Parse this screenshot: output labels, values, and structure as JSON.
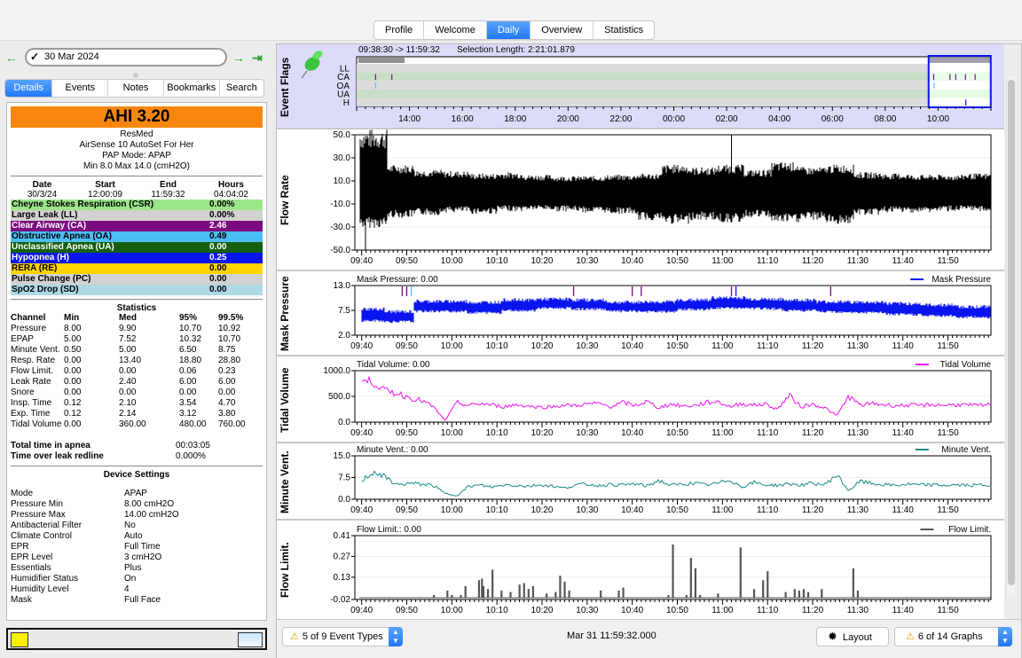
{
  "main_tabs": [
    {
      "label": "Profile",
      "active": false
    },
    {
      "label": "Welcome",
      "active": false
    },
    {
      "label": "Daily",
      "active": true
    },
    {
      "label": "Overview",
      "active": false
    },
    {
      "label": "Statistics",
      "active": false
    }
  ],
  "nav": {
    "date": "30 Mar 2024",
    "back_icon": "arrow-left-icon",
    "forward_icon": "arrow-right-icon",
    "last_icon": "arrow-to-end-icon"
  },
  "left_tabs": [
    {
      "label": "Details",
      "active": true
    },
    {
      "label": "Events",
      "active": false
    },
    {
      "label": "Notes",
      "active": false
    },
    {
      "label": "Bookmarks",
      "active": false
    },
    {
      "label": "Search",
      "active": false
    }
  ],
  "summary": {
    "ahi_label": "AHI  3.20",
    "ahi_color": "#f7860e",
    "device_lines": [
      "ResMed",
      "AirSense 10 AutoSet For Her",
      "PAP Mode: APAP",
      "Min 8.0 Max 14.0 (cmH2O)"
    ],
    "session_headers": [
      "Date",
      "Start",
      "End",
      "Hours"
    ],
    "session_values": [
      "30/3/24",
      "12:00:09",
      "11:59:32",
      "04:04:02"
    ]
  },
  "events": [
    {
      "label": "Cheyne Stokes Respiration (CSR)",
      "value": "0.00%",
      "bg": "#9be58a",
      "fg": "#000000"
    },
    {
      "label": "Large Leak (LL)",
      "value": "0.00%",
      "bg": "#d2d2d2",
      "fg": "#000000"
    },
    {
      "label": "Clear Airway (CA)",
      "value": "2.46",
      "bg": "#7a0b7e",
      "fg": "#ffffff"
    },
    {
      "label": "Obstructive Apnea (OA)",
      "value": "0.49",
      "bg": "#4dbdf5",
      "fg": "#000000"
    },
    {
      "label": "Unclassified Apnea (UA)",
      "value": "0.00",
      "bg": "#155f0e",
      "fg": "#ffffff"
    },
    {
      "label": "Hypopnea (H)",
      "value": "0.25",
      "bg": "#0a14ee",
      "fg": "#ffffff"
    },
    {
      "label": "RERA (RE)",
      "value": "0.00",
      "bg": "#ffd400",
      "fg": "#000000"
    },
    {
      "label": "Pulse Change (PC)",
      "value": "0.00",
      "bg": "#d2d2d2",
      "fg": "#000000"
    },
    {
      "label": "SpO2 Drop (SD)",
      "value": "0.00",
      "bg": "#add8e6",
      "fg": "#000000"
    }
  ],
  "statistics": {
    "title": "Statistics",
    "headers": [
      "Channel",
      "Min",
      "Med",
      "95%",
      "99.5%"
    ],
    "rows": [
      [
        "Pressure",
        "8.00",
        "9.90",
        "10.70",
        "10.92"
      ],
      [
        "EPAP",
        "5.00",
        "7.52",
        "10.32",
        "10.70"
      ],
      [
        "Minute Vent.",
        "0.50",
        "5.00",
        "6.50",
        "8.75"
      ],
      [
        "Resp. Rate",
        "0.00",
        "13.40",
        "18.80",
        "28.80"
      ],
      [
        "Flow Limit.",
        "0.00",
        "0.00",
        "0.06",
        "0.23"
      ],
      [
        "Leak Rate",
        "0.00",
        "2.40",
        "6.00",
        "6.00"
      ],
      [
        "Snore",
        "0.00",
        "0.00",
        "0.00",
        "0.00"
      ],
      [
        "Insp. Time",
        "0.12",
        "2.10",
        "3.54",
        "4.70"
      ],
      [
        "Exp. Time",
        "0.12",
        "2.14",
        "3.12",
        "3.80"
      ],
      [
        "Tidal Volume",
        "0.00",
        "360.00",
        "480.00",
        "760.00"
      ]
    ]
  },
  "totals": [
    {
      "label": "Total time in apnea",
      "value": "00:03:05"
    },
    {
      "label": "Time over leak redline",
      "value": "0.000%"
    }
  ],
  "device_settings": {
    "title": "Device Settings",
    "rows": [
      [
        "Mode",
        "APAP"
      ],
      [
        "Pressure Min",
        "8.00 cmH2O"
      ],
      [
        "Pressure Max",
        "14.00 cmH2O"
      ],
      [
        "Antibacterial Filter",
        "No"
      ],
      [
        "Climate Control",
        "Auto"
      ],
      [
        "EPR",
        "Full Time"
      ],
      [
        "EPR Level",
        "3 cmH2O"
      ],
      [
        "Essentials",
        "Plus"
      ],
      [
        "Humidifier Status",
        "On"
      ],
      [
        "Humidity Level",
        "4"
      ],
      [
        "Mask",
        "Full Face"
      ]
    ]
  },
  "event_flags": {
    "title": "Event Flags",
    "range_text": "09:38:30 -> 11:59:32",
    "selection_text": "Selection Length: 2:21:01.879",
    "rows": [
      "LL",
      "CA",
      "OA",
      "UA",
      "H"
    ],
    "x_ticks": [
      "14:00",
      "16:00",
      "18:00",
      "20:00",
      "22:00",
      "00:00",
      "02:00",
      "04:00",
      "06:00",
      "08:00",
      "10:00"
    ],
    "x_range": [
      "12:00",
      "12:00"
    ],
    "selection": [
      "09:38:30",
      "11:59:32"
    ],
    "markers": [
      {
        "row": "CA",
        "time": "12:43",
        "color": "#7a0b7e"
      },
      {
        "row": "CA",
        "time": "13:20",
        "color": "#7a0b7e"
      },
      {
        "row": "OA",
        "time": "12:43",
        "color": "#4dbdf5"
      },
      {
        "row": "CA",
        "time": "09:50",
        "color": "#7a0b7e"
      },
      {
        "row": "CA",
        "time": "10:27",
        "color": "#7a0b7e"
      },
      {
        "row": "CA",
        "time": "10:40",
        "color": "#7a0b7e"
      },
      {
        "row": "CA",
        "time": "11:02",
        "color": "#7a0b7e"
      },
      {
        "row": "CA",
        "time": "11:24",
        "color": "#7a0b7e"
      },
      {
        "row": "OA",
        "time": "09:51",
        "color": "#4dbdf5"
      },
      {
        "row": "H",
        "time": "11:03",
        "color": "#0a14ee"
      }
    ]
  },
  "chart_data": [
    {
      "type": "line",
      "title": "Flow Rate",
      "ylabel": "Flow Rate",
      "ylim": [
        -50,
        50
      ],
      "y_ticks": [
        "50.0",
        "30.0",
        "10.0",
        "-10.0",
        "-30.0",
        "-50.0"
      ],
      "x_ticks": [
        "09:40",
        "09:50",
        "10:00",
        "10:10",
        "10:20",
        "10:30",
        "10:40",
        "10:50",
        "11:00",
        "11:10",
        "11:20",
        "11:30",
        "11:40",
        "11:50"
      ],
      "x_range": [
        "09:38:30",
        "11:59:32"
      ],
      "series": [
        {
          "name": "Flow Rate",
          "color": "#000000",
          "envelope_upper": [
            50,
            22,
            18,
            17,
            15,
            16,
            14,
            13,
            13,
            14,
            15,
            22,
            20,
            22,
            18,
            24,
            20,
            22,
            16,
            15,
            14,
            14,
            15
          ],
          "envelope_lower": [
            -28,
            -20,
            -18,
            -16,
            -17,
            -15,
            -14,
            -15,
            -16,
            -17,
            -22,
            -25,
            -22,
            -24,
            -20,
            -24,
            -22,
            -25,
            -18,
            -16,
            -16,
            -15,
            -15
          ]
        }
      ]
    },
    {
      "type": "area",
      "title": "Mask Pressure",
      "header": "Mask Pressure: 0.00",
      "legend": "Mask Pressure",
      "ylabel": "Mask Pressure",
      "ylim": [
        2,
        13
      ],
      "y_ticks": [
        "13.0",
        "7.5",
        "2.0"
      ],
      "x_ticks": [
        "09:40",
        "09:50",
        "10:00",
        "10:10",
        "10:20",
        "10:30",
        "10:40",
        "10:50",
        "11:00",
        "11:10",
        "11:20",
        "11:30",
        "11:40",
        "11:50"
      ],
      "series": [
        {
          "name": "Mask Pressure",
          "color": "#0a14ee",
          "upper": [
            7.8,
            7.2,
            9.5,
            9.3,
            9.8,
            10.0,
            9.8,
            9.3,
            9.4,
            9.8,
            10.3,
            10.0,
            9.8,
            9.4,
            9.3,
            9.0,
            8.7,
            8.3
          ],
          "lower": [
            5.2,
            5.0,
            7.3,
            7.0,
            7.5,
            8.0,
            7.8,
            7.3,
            7.2,
            7.7,
            8.0,
            7.9,
            7.5,
            7.2,
            7.0,
            6.6,
            6.3,
            6.0
          ]
        }
      ],
      "flag_markers": [
        {
          "time": "09:49",
          "color": "#7a0b7e"
        },
        {
          "time": "09:50",
          "color": "#7a0b7e"
        },
        {
          "time": "09:51",
          "color": "#4dbdf5"
        },
        {
          "time": "10:27",
          "color": "#7a0b7e"
        },
        {
          "time": "10:40",
          "color": "#7a0b7e"
        },
        {
          "time": "10:42",
          "color": "#7a0b7e"
        },
        {
          "time": "11:02",
          "color": "#7a0b7e"
        },
        {
          "time": "11:03",
          "color": "#0a14ee"
        },
        {
          "time": "11:24",
          "color": "#7a0b7e"
        }
      ]
    },
    {
      "type": "line",
      "title": "Tidal Volume",
      "header": "Tidal Volume: 0.00",
      "legend": "Tidal Volume",
      "ylabel": "Tidal Volume",
      "ylim": [
        0,
        1000
      ],
      "y_ticks": [
        "1000.0",
        "500.0",
        "0.0"
      ],
      "x_ticks": [
        "09:40",
        "09:50",
        "10:00",
        "10:10",
        "10:20",
        "10:30",
        "10:40",
        "10:50",
        "11:00",
        "11:10",
        "11:20",
        "11:30",
        "11:40",
        "11:50"
      ],
      "series": [
        {
          "name": "Tidal Volume",
          "color": "#ee10ee",
          "values": [
            800,
            780,
            600,
            560,
            480,
            420,
            300,
            30,
            380,
            320,
            360,
            330,
            300,
            340,
            310,
            290,
            300,
            330,
            320,
            350,
            360,
            300,
            380,
            320,
            400,
            280,
            350,
            310,
            320,
            380,
            400,
            300,
            360,
            330,
            350,
            250,
            520,
            300,
            350,
            280,
            120,
            500,
            330,
            360,
            340,
            320,
            330,
            320,
            340,
            330,
            340,
            330,
            320,
            340
          ]
        }
      ]
    },
    {
      "type": "line",
      "title": "Minute Vent.",
      "header": "Minute Vent.: 0.00",
      "legend": "Minute Vent.",
      "ylabel": "Minute Vent.",
      "ylim": [
        0,
        15
      ],
      "y_ticks": [
        "15.0",
        "7.5",
        "0.0"
      ],
      "x_ticks": [
        "09:40",
        "09:50",
        "10:00",
        "10:10",
        "10:20",
        "10:30",
        "10:40",
        "10:50",
        "11:00",
        "11:10",
        "11:20",
        "11:30",
        "11:40",
        "11:50"
      ],
      "series": [
        {
          "name": "Minute Vent.",
          "color": "#1a8a8a",
          "values": [
            6.5,
            9.5,
            7.5,
            5.0,
            5.5,
            5.2,
            4.8,
            2.0,
            1.2,
            4.5,
            4.8,
            4.2,
            5.0,
            4.8,
            4.5,
            5.0,
            4.6,
            3.8,
            4.9,
            5.2,
            4.7,
            5.1,
            4.9,
            5.3,
            4.5,
            6.5,
            4.8,
            5.2,
            5.6,
            4.9,
            5.5,
            6.8,
            4.2,
            5.8,
            5.0,
            4.8,
            5.3,
            4.9,
            5.5,
            5.0,
            8.5,
            3.0,
            6.2,
            5.4,
            5.0,
            4.8,
            5.2,
            4.9,
            5.0,
            4.8,
            4.9,
            4.8,
            4.9,
            4.8
          ]
        }
      ]
    },
    {
      "type": "bar",
      "title": "Flow Limit.",
      "header": "Flow Limit.: 0.00",
      "legend": "Flow Limit.",
      "ylabel": "Flow Limit.",
      "ylim": [
        -0.02,
        0.41
      ],
      "y_ticks": [
        "0.41",
        "0.27",
        "0.13",
        "-0.02"
      ],
      "x_ticks": [
        "09:40",
        "09:50",
        "10:00",
        "10:10",
        "10:20",
        "10:30",
        "10:40",
        "10:50",
        "11:00",
        "11:10",
        "11:20",
        "11:30",
        "11:40",
        "11:50"
      ],
      "series": [
        {
          "name": "Flow Limit.",
          "color": "#555555",
          "spikes": [
            [
              "09:56",
              0.01
            ],
            [
              "09:59",
              0.04
            ],
            [
              "10:00",
              0.01
            ],
            [
              "10:02",
              0.01
            ],
            [
              "10:03",
              0.07
            ],
            [
              "10:06",
              0.11
            ],
            [
              "10:06:40",
              0.12
            ],
            [
              "10:07",
              0.07
            ],
            [
              "10:08",
              0.05
            ],
            [
              "10:09",
              0.18
            ],
            [
              "10:11",
              0.04
            ],
            [
              "10:13",
              0.03
            ],
            [
              "10:15",
              0.08
            ],
            [
              "10:16",
              0.09
            ],
            [
              "10:17",
              0.05
            ],
            [
              "10:18",
              0.07
            ],
            [
              "10:21",
              0.02
            ],
            [
              "10:23",
              0.03
            ],
            [
              "10:24",
              0.14
            ],
            [
              "10:25",
              0.1
            ],
            [
              "10:26",
              0.04
            ],
            [
              "10:33",
              0.04
            ],
            [
              "10:37",
              0.04
            ],
            [
              "10:38",
              0.06
            ],
            [
              "10:48",
              0.01
            ],
            [
              "10:49",
              0.35
            ],
            [
              "10:52",
              0.01
            ],
            [
              "10:53",
              0.26
            ],
            [
              "10:54",
              0.19
            ],
            [
              "10:55",
              0.01
            ],
            [
              "10:59",
              0.02
            ],
            [
              "11:04",
              0.33
            ],
            [
              "11:07",
              0.05
            ],
            [
              "11:09",
              0.11
            ],
            [
              "11:10",
              0.17
            ],
            [
              "11:14",
              0.03
            ],
            [
              "11:16",
              0.05
            ],
            [
              "11:17",
              0.04
            ],
            [
              "11:18",
              0.05
            ],
            [
              "11:19",
              0.03
            ],
            [
              "11:22",
              0.05
            ],
            [
              "11:29",
              0.19
            ],
            [
              "11:30",
              0.04
            ]
          ]
        }
      ]
    }
  ],
  "footer": {
    "event_types": "5 of 9 Event Types",
    "timestamp": "Mar 31 11:59:32.000",
    "layout": "Layout",
    "graphs": "6 of 14 Graphs"
  }
}
